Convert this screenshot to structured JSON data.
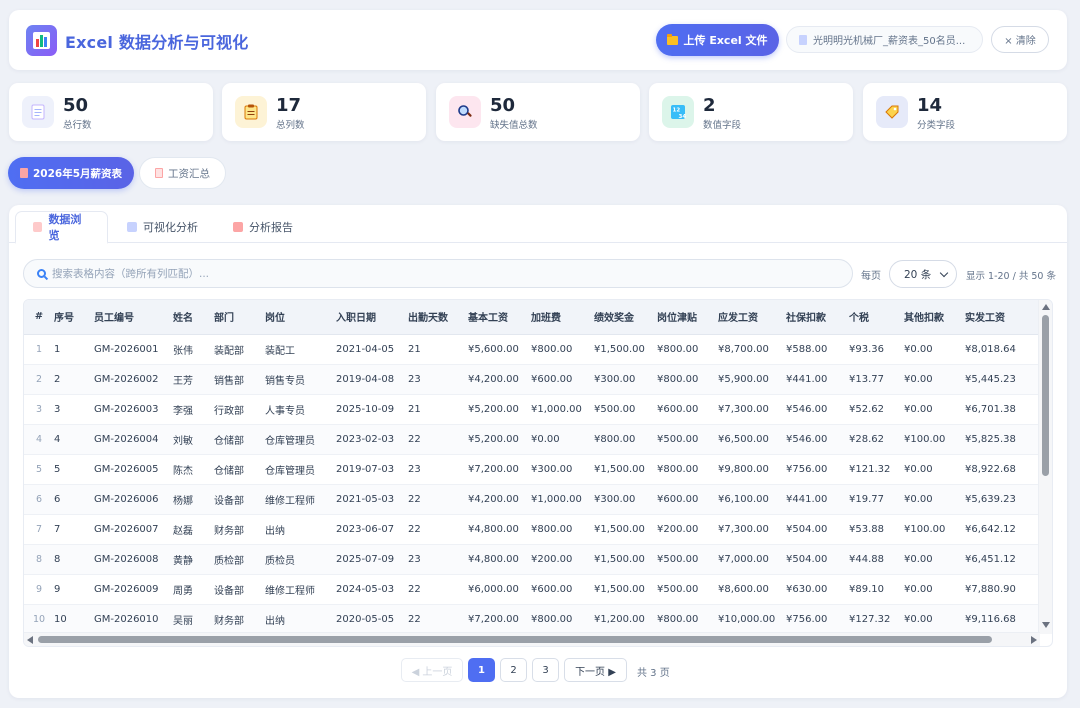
{
  "app": {
    "title": "Excel 数据分析与可视化",
    "upload_label": "上传 Excel 文件",
    "file_name": "光明明光机械厂_薪资表_50名员...",
    "clear_label": "× 清除"
  },
  "stats": [
    {
      "value": "50",
      "label": "总行数",
      "icon": "document-icon",
      "bg": "#eef1fb"
    },
    {
      "value": "17",
      "label": "总列数",
      "icon": "clipboard-icon",
      "bg": "#fdf3d6"
    },
    {
      "value": "50",
      "label": "缺失值总数",
      "icon": "magnifier-icon",
      "bg": "#fde6ef"
    },
    {
      "value": "2",
      "label": "数值字段",
      "icon": "numbers-icon",
      "bg": "#dcf5ea"
    },
    {
      "value": "14",
      "label": "分类字段",
      "icon": "tag-icon",
      "bg": "#e6eaf9"
    }
  ],
  "sheets": {
    "active": "2026年5月薪资表",
    "other": "工资汇总"
  },
  "view_tabs": {
    "browse": "数据浏览",
    "visual": "可视化分析",
    "report": "分析报告"
  },
  "search": {
    "placeholder": "搜索表格内容（跨所有列匹配）..."
  },
  "per_page": {
    "label": "每页",
    "value": "20 条",
    "range": "显示 1-20 / 共 50 条"
  },
  "table": {
    "headers": [
      "#",
      "序号",
      "员工编号",
      "姓名",
      "部门",
      "岗位",
      "入职日期",
      "出勤天数",
      "基本工资",
      "加班费",
      "绩效奖金",
      "岗位津贴",
      "应发工资",
      "社保扣款",
      "个税",
      "其他扣款",
      "实发工资"
    ],
    "rows": [
      [
        "1",
        "1",
        "GM-2026001",
        "张伟",
        "装配部",
        "装配工",
        "2021-04-05",
        "21",
        "¥5,600.00",
        "¥800.00",
        "¥1,500.00",
        "¥800.00",
        "¥8,700.00",
        "¥588.00",
        "¥93.36",
        "¥0.00",
        "¥8,018.64"
      ],
      [
        "2",
        "2",
        "GM-2026002",
        "王芳",
        "销售部",
        "销售专员",
        "2019-04-08",
        "23",
        "¥4,200.00",
        "¥600.00",
        "¥300.00",
        "¥800.00",
        "¥5,900.00",
        "¥441.00",
        "¥13.77",
        "¥0.00",
        "¥5,445.23"
      ],
      [
        "3",
        "3",
        "GM-2026003",
        "李强",
        "行政部",
        "人事专员",
        "2025-10-09",
        "21",
        "¥5,200.00",
        "¥1,000.00",
        "¥500.00",
        "¥600.00",
        "¥7,300.00",
        "¥546.00",
        "¥52.62",
        "¥0.00",
        "¥6,701.38"
      ],
      [
        "4",
        "4",
        "GM-2026004",
        "刘敏",
        "仓储部",
        "仓库管理员",
        "2023-02-03",
        "22",
        "¥5,200.00",
        "¥0.00",
        "¥800.00",
        "¥500.00",
        "¥6,500.00",
        "¥546.00",
        "¥28.62",
        "¥100.00",
        "¥5,825.38"
      ],
      [
        "5",
        "5",
        "GM-2026005",
        "陈杰",
        "仓储部",
        "仓库管理员",
        "2019-07-03",
        "23",
        "¥7,200.00",
        "¥300.00",
        "¥1,500.00",
        "¥800.00",
        "¥9,800.00",
        "¥756.00",
        "¥121.32",
        "¥0.00",
        "¥8,922.68"
      ],
      [
        "6",
        "6",
        "GM-2026006",
        "杨娜",
        "设备部",
        "维修工程师",
        "2021-05-03",
        "22",
        "¥4,200.00",
        "¥1,000.00",
        "¥300.00",
        "¥600.00",
        "¥6,100.00",
        "¥441.00",
        "¥19.77",
        "¥0.00",
        "¥5,639.23"
      ],
      [
        "7",
        "7",
        "GM-2026007",
        "赵磊",
        "财务部",
        "出纳",
        "2023-06-07",
        "22",
        "¥4,800.00",
        "¥800.00",
        "¥1,500.00",
        "¥200.00",
        "¥7,300.00",
        "¥504.00",
        "¥53.88",
        "¥100.00",
        "¥6,642.12"
      ],
      [
        "8",
        "8",
        "GM-2026008",
        "黄静",
        "质检部",
        "质检员",
        "2025-07-09",
        "23",
        "¥4,800.00",
        "¥200.00",
        "¥1,500.00",
        "¥500.00",
        "¥7,000.00",
        "¥504.00",
        "¥44.88",
        "¥0.00",
        "¥6,451.12"
      ],
      [
        "9",
        "9",
        "GM-2026009",
        "周勇",
        "设备部",
        "维修工程师",
        "2024-05-03",
        "22",
        "¥6,000.00",
        "¥600.00",
        "¥1,500.00",
        "¥500.00",
        "¥8,600.00",
        "¥630.00",
        "¥89.10",
        "¥0.00",
        "¥7,880.90"
      ],
      [
        "10",
        "10",
        "GM-2026010",
        "吴丽",
        "财务部",
        "出纳",
        "2020-05-05",
        "22",
        "¥7,200.00",
        "¥800.00",
        "¥1,200.00",
        "¥800.00",
        "¥10,000.00",
        "¥756.00",
        "¥127.32",
        "¥0.00",
        "¥9,116.68"
      ]
    ]
  },
  "pagination": {
    "prev": "◀ 上一页",
    "pages": [
      "1",
      "2",
      "3"
    ],
    "current": "1",
    "next": "下一页 ▶",
    "total": "共 3 页"
  },
  "colors": {
    "accent": "#4f6ef2",
    "title": "#4a66dd"
  }
}
